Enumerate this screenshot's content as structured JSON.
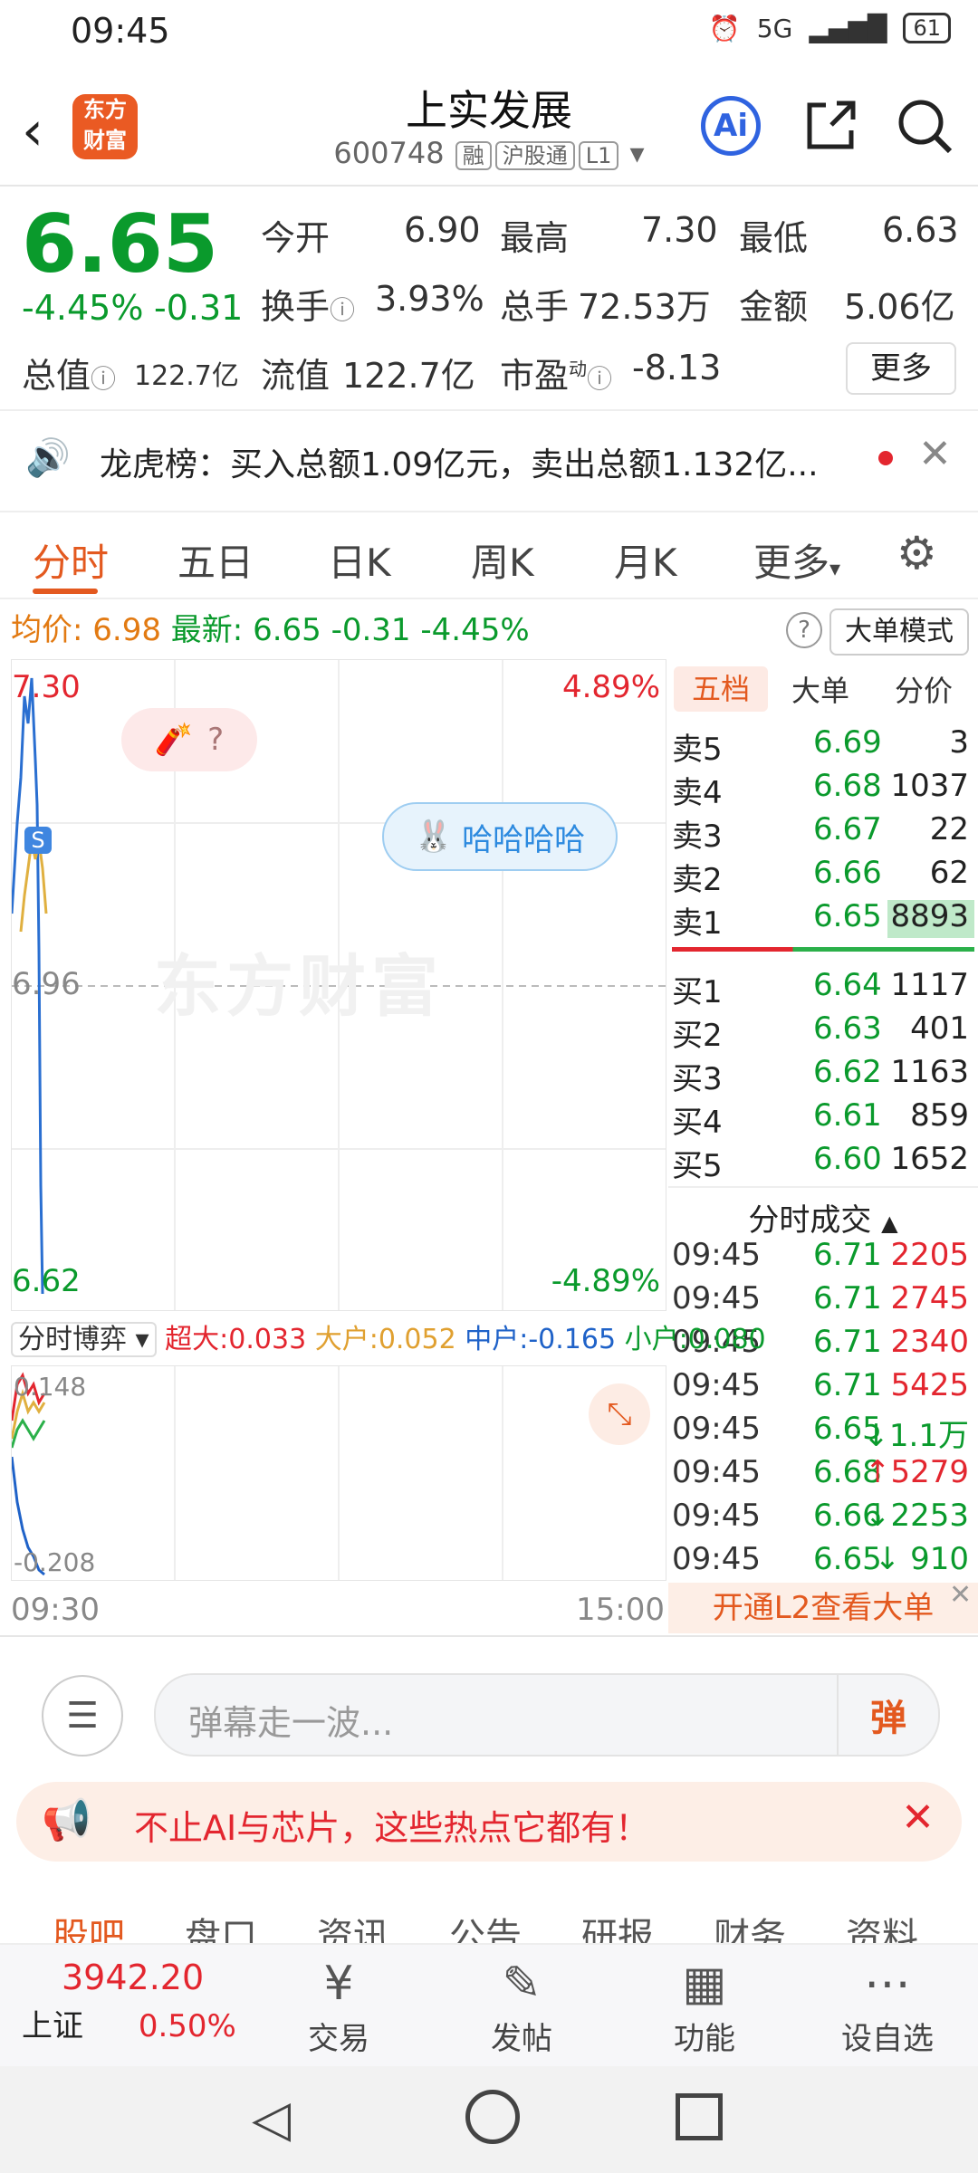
{
  "status": {
    "time": "09:45",
    "battery": "61",
    "net": "5G"
  },
  "header": {
    "logo_line1": "东方",
    "logo_line2": "财富",
    "title": "上实发展",
    "code": "600748",
    "tags": [
      "融",
      "沪股通",
      "L1"
    ],
    "ai_label": "Ai"
  },
  "quote": {
    "price": "6.65",
    "change_pct": "-4.45%",
    "change": "-0.31",
    "open_label": "今开",
    "open": "6.90",
    "high_label": "最高",
    "high": "7.30",
    "low_label": "最低",
    "low": "6.63",
    "turnover_label": "换手",
    "turnover": "3.93%",
    "volume_label": "总手",
    "volume": "72.53万",
    "amount_label": "金额",
    "amount": "5.06亿",
    "total_cap_label": "总值",
    "total_cap": "122.7亿",
    "float_cap_label": "流值",
    "float_cap": "122.7亿",
    "pe_label": "市盈",
    "pe_sup": "动",
    "pe": "-8.13",
    "more": "更多"
  },
  "notice": {
    "text": "龙虎榜：买入总额1.09亿元，卖出总额1.132亿..."
  },
  "tabs": [
    "分时",
    "五日",
    "日K",
    "周K",
    "月K",
    "更多"
  ],
  "avg_line": {
    "avg_label": "均价:",
    "avg": "6.98",
    "latest_label": "最新:",
    "latest": "6.65",
    "chg": "-0.31",
    "pct": "-4.45%",
    "big_mode": "大单模式"
  },
  "chart": {
    "y_top": "7.30",
    "y_mid": "6.96",
    "y_bot": "6.62",
    "pct_top": "4.89%",
    "pct_bot": "-4.89%",
    "bubble1": "?",
    "bubble2": "哈哈哈哈",
    "watermark": "东方财富",
    "time_start": "09:30",
    "time_end": "15:00"
  },
  "order_book": {
    "tabs": [
      "五档",
      "大单",
      "分价"
    ],
    "asks": [
      {
        "label": "卖5",
        "price": "6.69",
        "vol": "3"
      },
      {
        "label": "卖4",
        "price": "6.68",
        "vol": "1037"
      },
      {
        "label": "卖3",
        "price": "6.67",
        "vol": "22"
      },
      {
        "label": "卖2",
        "price": "6.66",
        "vol": "62"
      },
      {
        "label": "卖1",
        "price": "6.65",
        "vol": "8893"
      }
    ],
    "bids": [
      {
        "label": "买1",
        "price": "6.64",
        "vol": "1117"
      },
      {
        "label": "买2",
        "price": "6.63",
        "vol": "401"
      },
      {
        "label": "买3",
        "price": "6.62",
        "vol": "1163"
      },
      {
        "label": "买4",
        "price": "6.61",
        "vol": "859"
      },
      {
        "label": "买5",
        "price": "6.60",
        "vol": "1652"
      }
    ],
    "ticks_title": "分时成交",
    "ticks": [
      {
        "time": "09:45",
        "price": "6.71",
        "vol": "2205",
        "arrow": ""
      },
      {
        "time": "09:45",
        "price": "6.71",
        "vol": "2745",
        "arrow": ""
      },
      {
        "time": "09:45",
        "price": "6.71",
        "vol": "2340",
        "arrow": ""
      },
      {
        "time": "09:45",
        "price": "6.71",
        "vol": "5425",
        "arrow": ""
      },
      {
        "time": "09:45",
        "price": "6.65",
        "vol": "1.1万",
        "arrow": "↓"
      },
      {
        "time": "09:45",
        "price": "6.68",
        "vol": "5279",
        "arrow": "↑"
      },
      {
        "time": "09:45",
        "price": "6.66",
        "vol": "2253",
        "arrow": "↓"
      },
      {
        "time": "09:45",
        "price": "6.65",
        "vol": " 910",
        "arrow": "↓"
      }
    ],
    "l2_banner": "开通L2查看大单"
  },
  "flow": {
    "mode": "分时博弈",
    "super_label": "超大:",
    "super": "0.033",
    "big_label": "大户:",
    "big": "0.052",
    "mid_label": "中户:",
    "mid": "-0.165",
    "small_label": "小户:",
    "small": "0.080",
    "y_top": "0.148",
    "y_bot": "-0.208"
  },
  "comment": {
    "placeholder": "弹幕走一波...",
    "danmu": "弹"
  },
  "promo": {
    "text": "不止AI与芯片，这些热点它都有！"
  },
  "subnav": [
    "股吧",
    "盘口",
    "资讯",
    "公告",
    "研报",
    "财务",
    "资料"
  ],
  "bottom": {
    "index_value": "3942.20",
    "index_name": "上证",
    "index_pct": "0.50%",
    "items": [
      "交易",
      "发帖",
      "功能",
      "设自选"
    ]
  },
  "colors": {
    "up": "#e3262f",
    "down": "#0a9a2c",
    "accent": "#e3591f",
    "avg": "#e0a030",
    "line": "#2a6fd1"
  }
}
